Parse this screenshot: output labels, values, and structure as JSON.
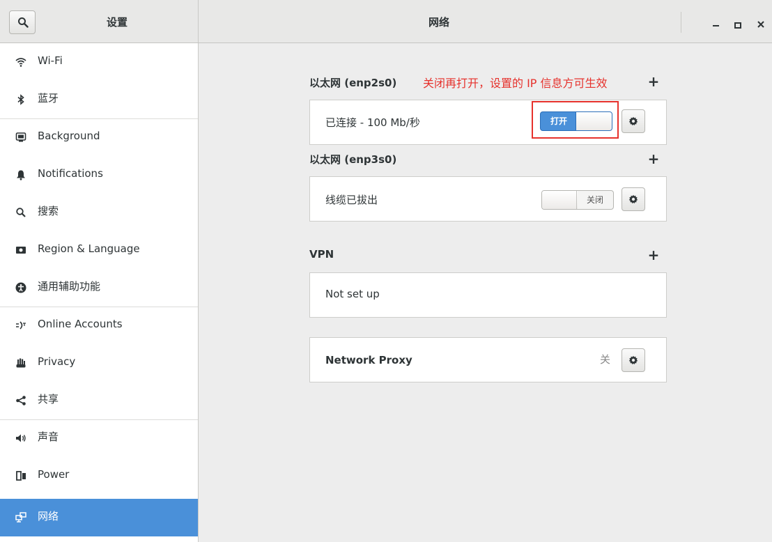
{
  "header": {
    "settings_title": "设置",
    "window_title": "网络"
  },
  "sidebar": {
    "items": [
      {
        "label": "Wi-Fi",
        "icon": "wifi-icon"
      },
      {
        "label": "蓝牙",
        "icon": "bluetooth-icon"
      },
      {
        "label": "Background",
        "icon": "background-icon"
      },
      {
        "label": "Notifications",
        "icon": "bell-icon"
      },
      {
        "label": "搜索",
        "icon": "search-icon"
      },
      {
        "label": "Region & Language",
        "icon": "region-icon"
      },
      {
        "label": "通用辅助功能",
        "icon": "accessibility-icon"
      },
      {
        "label": "Online Accounts",
        "icon": "online-accounts-icon"
      },
      {
        "label": "Privacy",
        "icon": "hand-icon"
      },
      {
        "label": "共享",
        "icon": "share-icon"
      },
      {
        "label": "声音",
        "icon": "speaker-icon"
      },
      {
        "label": "Power",
        "icon": "power-icon"
      },
      {
        "label": "网络",
        "icon": "network-icon",
        "active": true
      }
    ]
  },
  "main": {
    "eth1": {
      "title": "以太网 (enp2s0)",
      "annotation": "关闭再打开，设置的 IP 信息方可生效",
      "status": "已连接 - 100 Mb/秒",
      "switch_label": "打开",
      "switch_on": true
    },
    "eth2": {
      "title": "以太网 (enp3s0)",
      "status": "线缆已拔出",
      "switch_label": "关闭",
      "switch_on": false
    },
    "vpn": {
      "title": "VPN",
      "status": "Not set up"
    },
    "proxy": {
      "label": "Network Proxy",
      "state": "关"
    },
    "add_symbol": "+"
  },
  "colors": {
    "accent": "#4a90d9",
    "annotation": "#e6312c"
  }
}
